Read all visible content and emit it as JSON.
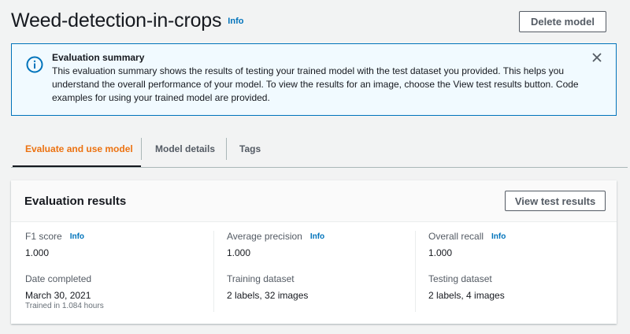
{
  "header": {
    "title": "Weed-detection-in-crops",
    "info": "Info",
    "delete_label": "Delete model"
  },
  "flash": {
    "title": "Evaluation summary",
    "text": "This evaluation summary shows the results of testing your trained model with the test dataset you provided. This helps you understand the overall performance of your model. To view the results for an image, choose the View test results button. Code examples for using your trained model are provided.",
    "icon": "info-circle-icon",
    "close_icon": "close-icon"
  },
  "tabs": [
    {
      "label": "Evaluate and use model",
      "active": true
    },
    {
      "label": "Model details",
      "active": false
    },
    {
      "label": "Tags",
      "active": false
    }
  ],
  "evaluation": {
    "title": "Evaluation results",
    "view_label": "View test results",
    "f1": {
      "label": "F1 score",
      "info": "Info",
      "value": "1.000"
    },
    "precision": {
      "label": "Average precision",
      "info": "Info",
      "value": "1.000"
    },
    "recall": {
      "label": "Overall recall",
      "info": "Info",
      "value": "1.000"
    },
    "date": {
      "label": "Date completed",
      "value": "March 30, 2021",
      "sub": "Trained in 1.084 hours"
    },
    "training": {
      "label": "Training dataset",
      "value": "2 labels, 32 images"
    },
    "testing": {
      "label": "Testing dataset",
      "value": "2 labels, 4 images"
    }
  },
  "colors": {
    "accent": "#0073bb",
    "active_tab": "#ec7211",
    "flash_bg": "#f1faff"
  }
}
